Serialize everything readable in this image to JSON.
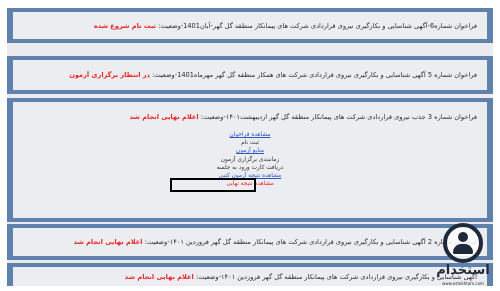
{
  "rows": [
    {
      "title": "فراخوان شماره6-آگهی شناسایی و بکارگیری نیروی قراردادی شرکت های پیمانکار منطقه گل گهر-آبان1401-وضعیت:",
      "status": "ثبت نام شروع شده"
    },
    {
      "title": "فراخوان شماره 5 آگهی شناسایی و بکارگیری نیروی قراردادی شرکت های همکار منطقه گل گهر مهرماه1401-وضعیت:",
      "status": "در انتظار برگزاری آزمون"
    },
    {
      "title": "فراخوان شماره 3 جذب نیروی قراردادی شرکت های پیمانکار منطقه گل گهر اردیبهشت۱۴۰۱-وضعیت:",
      "status": "اعلام نهایی انجام شد"
    },
    {
      "title": "فراخوان شماره 2 آگهی شناسایی و بکارگیری نیروی قراردادی شرکت های پیمانکار منطقه گل گهر فروردین ۱۴۰۱-وضعیت:",
      "status": "اعلام نهایی انجام شد"
    },
    {
      "title": "آگهی شناسایی و بکارگیری نیروی قراردادی شرکت های پیمانکار منطقه گل گهر فروردین ۱۴۰۱-وضعیت:",
      "status": "اعلام نهایی انجام شد"
    }
  ],
  "links": {
    "view_call": "مشاهده فراخوان",
    "register": "ثبت نام",
    "exam_sources": "منابع آزمون",
    "exam_schedule": "زمانبندی برگزاری آزمون",
    "exam_card": "دریافت کارت ورود به جلسه",
    "view_result": "مشاهده نتیجه آزمون کتبی",
    "final_result": "مشاهده نتیجه نهایی"
  },
  "logo": {
    "name": "استخدام",
    "url": "www.estekhtam.com",
    "primary_color": "#1e2a3a"
  },
  "colors": {
    "band": "#5e82ab",
    "status": "#e82424",
    "link": "#2a56c6"
  }
}
